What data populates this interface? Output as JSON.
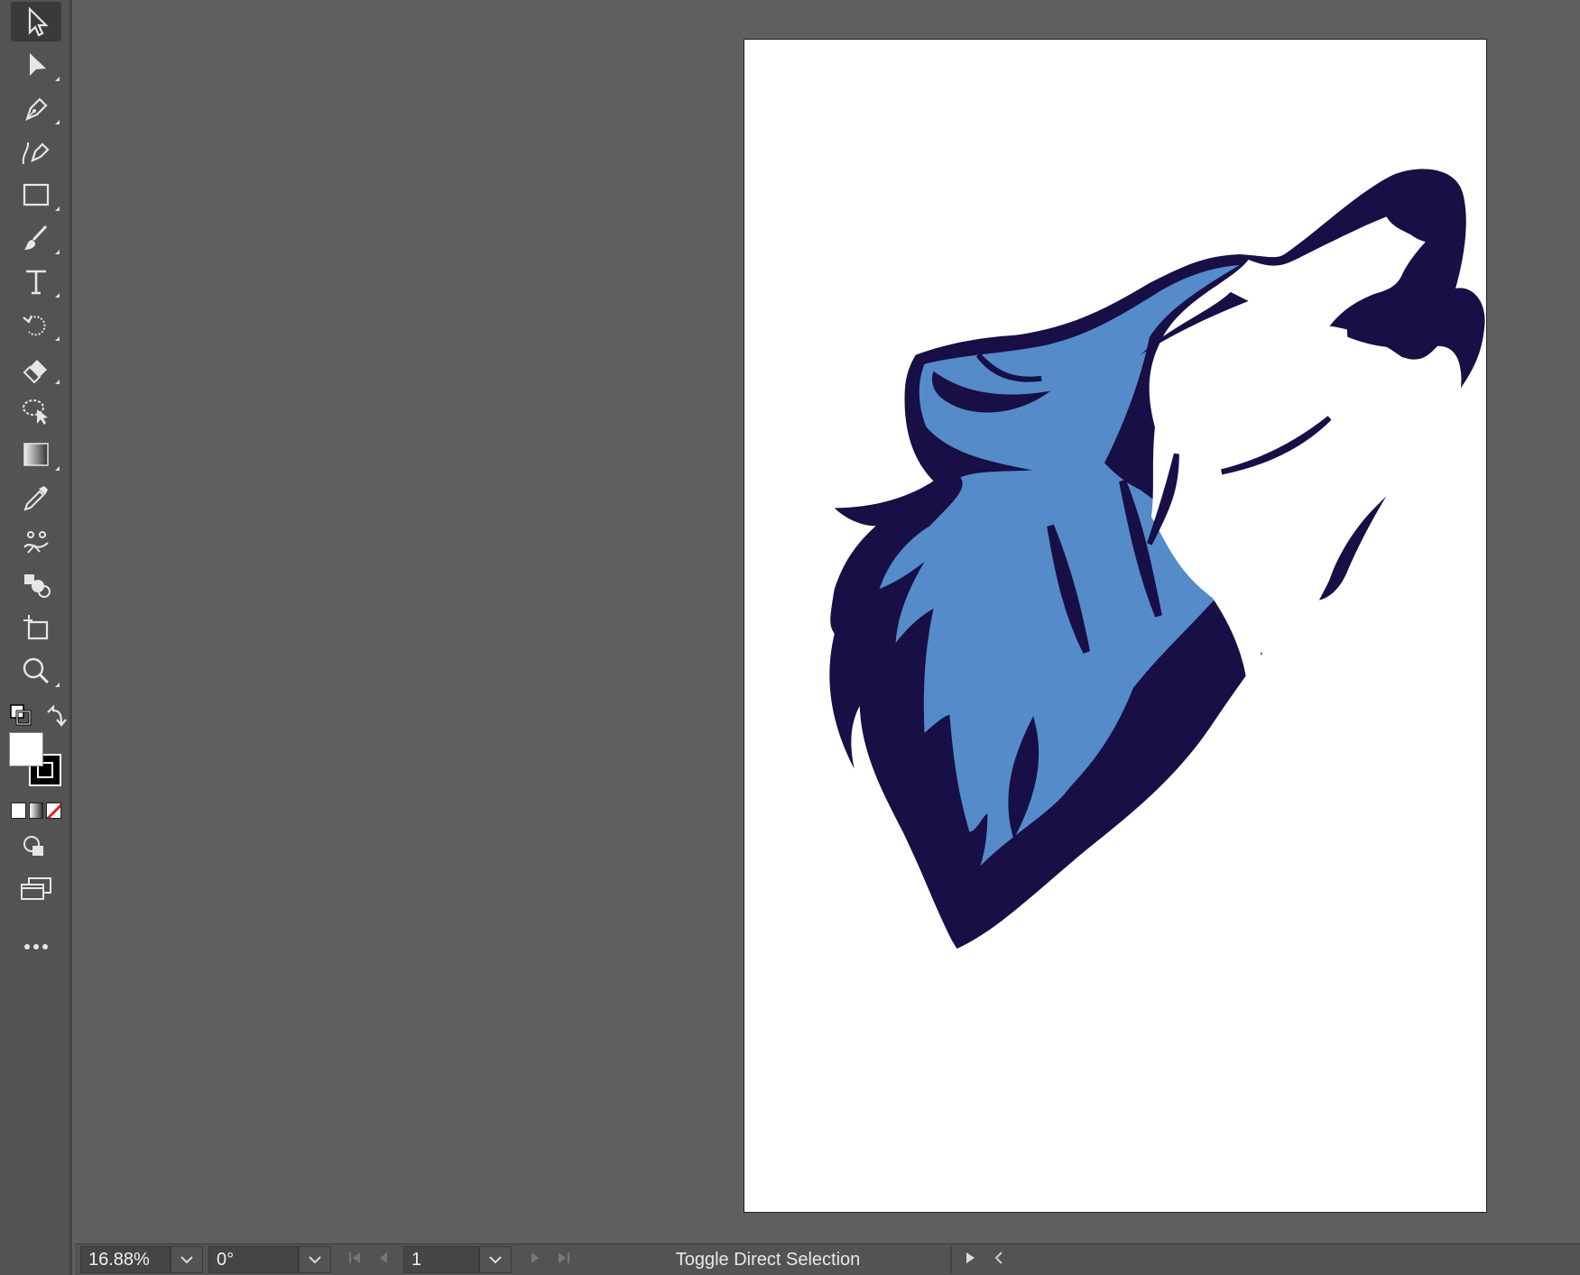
{
  "app": {
    "toolbar": {
      "tools": [
        {
          "name": "selection-tool",
          "icon": "selection-arrow-icon",
          "active": true
        },
        {
          "name": "direct-selection-tool",
          "icon": "direct-selection-arrow-icon"
        },
        {
          "name": "pen-tool",
          "icon": "pen-icon"
        },
        {
          "name": "curvature-tool",
          "icon": "curvature-pen-icon"
        },
        {
          "name": "rectangle-tool",
          "icon": "rectangle-icon"
        },
        {
          "name": "paintbrush-tool",
          "icon": "paintbrush-icon"
        },
        {
          "name": "type-tool",
          "icon": "type-icon"
        },
        {
          "name": "rotate-tool",
          "icon": "rotate-icon"
        },
        {
          "name": "eraser-tool",
          "icon": "eraser-icon"
        },
        {
          "name": "lasso-tool",
          "icon": "lasso-icon"
        },
        {
          "name": "gradient-tool",
          "icon": "gradient-icon"
        },
        {
          "name": "eyedropper-tool",
          "icon": "eyedropper-icon"
        },
        {
          "name": "puppet-warp-tool",
          "icon": "puppet-warp-icon"
        },
        {
          "name": "shape-builder-tool",
          "icon": "shape-builder-icon"
        },
        {
          "name": "artboard-tool",
          "icon": "artboard-icon"
        },
        {
          "name": "zoom-tool",
          "icon": "zoom-icon"
        }
      ],
      "fill_color": "#ffffff",
      "stroke_color": "#000000"
    },
    "statusbar": {
      "zoom": "16.88%",
      "rotation": "0°",
      "artboard_number": "1",
      "status_text": "Toggle Direct Selection"
    },
    "colors": {
      "wolf_dark": "#170f45",
      "wolf_blue": "#548bc8",
      "wolf_white": "#ffffff"
    }
  }
}
